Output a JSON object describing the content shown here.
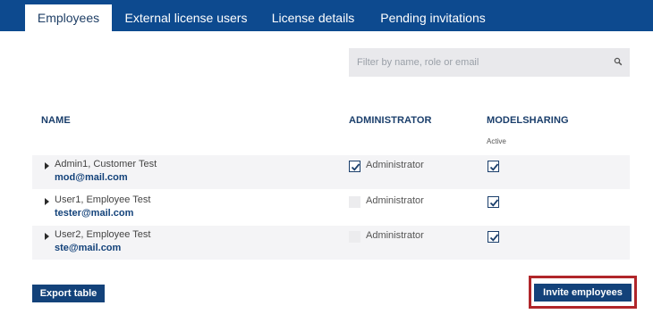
{
  "tabs": [
    {
      "label": "Employees",
      "active": true
    },
    {
      "label": "External license users",
      "active": false
    },
    {
      "label": "License details",
      "active": false
    },
    {
      "label": "Pending invitations",
      "active": false
    }
  ],
  "search": {
    "placeholder": "Filter by name, role or email",
    "icon": "search-icon"
  },
  "table": {
    "headers": {
      "name": "NAME",
      "administrator": "ADMINISTRATOR",
      "modelsharing": "MODELSHARING"
    },
    "modelsharing_sub": "Active",
    "rows": [
      {
        "name": "Admin1, Customer Test",
        "email": "mod@mail.com",
        "admin_label": "Administrator",
        "is_admin": true,
        "modelsharing": true
      },
      {
        "name": "User1, Employee Test",
        "email": "tester@mail.com",
        "admin_label": "Administrator",
        "is_admin": false,
        "modelsharing": true
      },
      {
        "name": "User2, Employee Test",
        "email": "ste@mail.com",
        "admin_label": "Administrator",
        "is_admin": false,
        "modelsharing": true
      }
    ]
  },
  "buttons": {
    "export": "Export table",
    "invite": "Invite employees"
  },
  "colors": {
    "brand": "#0d4a8f",
    "button": "#13427a",
    "highlight": "#b0262a"
  }
}
